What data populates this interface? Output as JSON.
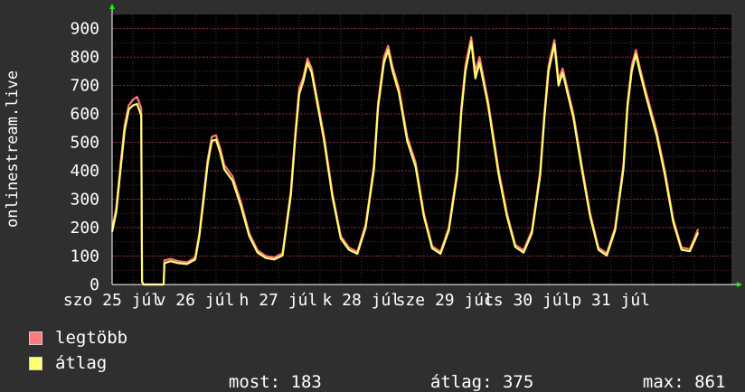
{
  "chart_data": {
    "type": "line",
    "ylabel": "onlinestream.live",
    "ylim": [
      0,
      950
    ],
    "yticks": [
      0,
      100,
      200,
      300,
      400,
      500,
      600,
      700,
      800,
      900
    ],
    "xlim": [
      0,
      7.45
    ],
    "x_tick_labels": [
      {
        "x": 0.0,
        "label": "szo 25 júl"
      },
      {
        "x": 1.0,
        "label": "v 26 júl"
      },
      {
        "x": 2.0,
        "label": "h 27 júl"
      },
      {
        "x": 3.0,
        "label": "k 28 júl"
      },
      {
        "x": 4.0,
        "label": "sze 29 júl"
      },
      {
        "x": 5.0,
        "label": "cs 30 júl"
      },
      {
        "x": 6.0,
        "label": "p 31 júl"
      }
    ],
    "grid": true,
    "colors": {
      "background": "#000000",
      "grid": "#5a2a2a",
      "series_max": "#ff7a7a",
      "series_avg": "#ffff70",
      "axis_arrow": "#00ff00"
    },
    "series": [
      {
        "name": "legtöbb",
        "color": "#ff7a7a",
        "points": [
          [
            0.0,
            195
          ],
          [
            0.05,
            270
          ],
          [
            0.1,
            420
          ],
          [
            0.15,
            560
          ],
          [
            0.2,
            630
          ],
          [
            0.25,
            650
          ],
          [
            0.3,
            660
          ],
          [
            0.35,
            620
          ],
          [
            0.36,
            10
          ],
          [
            0.38,
            0
          ],
          [
            0.62,
            0
          ],
          [
            0.63,
            85
          ],
          [
            0.7,
            90
          ],
          [
            0.8,
            82
          ],
          [
            0.9,
            78
          ],
          [
            1.0,
            95
          ],
          [
            1.05,
            180
          ],
          [
            1.1,
            310
          ],
          [
            1.15,
            440
          ],
          [
            1.2,
            520
          ],
          [
            1.25,
            525
          ],
          [
            1.3,
            480
          ],
          [
            1.35,
            420
          ],
          [
            1.45,
            380
          ],
          [
            1.55,
            290
          ],
          [
            1.65,
            180
          ],
          [
            1.75,
            120
          ],
          [
            1.85,
            100
          ],
          [
            1.95,
            95
          ],
          [
            2.05,
            110
          ],
          [
            2.15,
            330
          ],
          [
            2.2,
            520
          ],
          [
            2.25,
            690
          ],
          [
            2.3,
            730
          ],
          [
            2.35,
            795
          ],
          [
            2.4,
            760
          ],
          [
            2.45,
            680
          ],
          [
            2.55,
            520
          ],
          [
            2.65,
            320
          ],
          [
            2.75,
            170
          ],
          [
            2.85,
            130
          ],
          [
            2.95,
            115
          ],
          [
            3.05,
            210
          ],
          [
            3.15,
            420
          ],
          [
            3.2,
            640
          ],
          [
            3.27,
            800
          ],
          [
            3.32,
            840
          ],
          [
            3.37,
            770
          ],
          [
            3.45,
            690
          ],
          [
            3.55,
            520
          ],
          [
            3.65,
            430
          ],
          [
            3.75,
            250
          ],
          [
            3.85,
            135
          ],
          [
            3.95,
            115
          ],
          [
            4.05,
            200
          ],
          [
            4.15,
            400
          ],
          [
            4.2,
            620
          ],
          [
            4.25,
            770
          ],
          [
            4.32,
            870
          ],
          [
            4.37,
            750
          ],
          [
            4.42,
            800
          ],
          [
            4.52,
            650
          ],
          [
            4.65,
            400
          ],
          [
            4.75,
            250
          ],
          [
            4.85,
            140
          ],
          [
            4.95,
            120
          ],
          [
            5.05,
            190
          ],
          [
            5.15,
            400
          ],
          [
            5.2,
            600
          ],
          [
            5.25,
            770
          ],
          [
            5.32,
            860
          ],
          [
            5.37,
            720
          ],
          [
            5.42,
            760
          ],
          [
            5.55,
            600
          ],
          [
            5.65,
            420
          ],
          [
            5.75,
            250
          ],
          [
            5.85,
            130
          ],
          [
            5.95,
            110
          ],
          [
            6.05,
            200
          ],
          [
            6.15,
            420
          ],
          [
            6.2,
            640
          ],
          [
            6.25,
            770
          ],
          [
            6.3,
            825
          ],
          [
            6.35,
            760
          ],
          [
            6.42,
            680
          ],
          [
            6.55,
            540
          ],
          [
            6.65,
            400
          ],
          [
            6.75,
            230
          ],
          [
            6.85,
            130
          ],
          [
            6.95,
            125
          ],
          [
            7.05,
            195
          ]
        ]
      },
      {
        "name": "átlag",
        "color": "#ffff70",
        "points": [
          [
            0.0,
            185
          ],
          [
            0.05,
            255
          ],
          [
            0.1,
            400
          ],
          [
            0.15,
            540
          ],
          [
            0.2,
            615
          ],
          [
            0.25,
            630
          ],
          [
            0.3,
            635
          ],
          [
            0.35,
            595
          ],
          [
            0.36,
            10
          ],
          [
            0.38,
            0
          ],
          [
            0.62,
            0
          ],
          [
            0.63,
            75
          ],
          [
            0.7,
            82
          ],
          [
            0.8,
            75
          ],
          [
            0.9,
            72
          ],
          [
            1.0,
            88
          ],
          [
            1.05,
            170
          ],
          [
            1.1,
            295
          ],
          [
            1.15,
            425
          ],
          [
            1.2,
            505
          ],
          [
            1.25,
            510
          ],
          [
            1.3,
            465
          ],
          [
            1.35,
            405
          ],
          [
            1.45,
            365
          ],
          [
            1.55,
            275
          ],
          [
            1.65,
            170
          ],
          [
            1.75,
            112
          ],
          [
            1.85,
            93
          ],
          [
            1.95,
            88
          ],
          [
            2.05,
            102
          ],
          [
            2.15,
            315
          ],
          [
            2.2,
            505
          ],
          [
            2.25,
            670
          ],
          [
            2.3,
            715
          ],
          [
            2.35,
            780
          ],
          [
            2.4,
            745
          ],
          [
            2.45,
            665
          ],
          [
            2.55,
            505
          ],
          [
            2.65,
            308
          ],
          [
            2.75,
            162
          ],
          [
            2.85,
            122
          ],
          [
            2.95,
            108
          ],
          [
            3.05,
            200
          ],
          [
            3.15,
            405
          ],
          [
            3.2,
            625
          ],
          [
            3.27,
            780
          ],
          [
            3.32,
            825
          ],
          [
            3.37,
            755
          ],
          [
            3.45,
            675
          ],
          [
            3.55,
            505
          ],
          [
            3.65,
            415
          ],
          [
            3.75,
            240
          ],
          [
            3.85,
            127
          ],
          [
            3.95,
            108
          ],
          [
            4.05,
            190
          ],
          [
            4.15,
            385
          ],
          [
            4.2,
            605
          ],
          [
            4.25,
            750
          ],
          [
            4.32,
            855
          ],
          [
            4.37,
            725
          ],
          [
            4.42,
            780
          ],
          [
            4.52,
            635
          ],
          [
            4.65,
            385
          ],
          [
            4.75,
            240
          ],
          [
            4.85,
            132
          ],
          [
            4.95,
            112
          ],
          [
            5.05,
            180
          ],
          [
            5.15,
            385
          ],
          [
            5.2,
            585
          ],
          [
            5.25,
            750
          ],
          [
            5.32,
            845
          ],
          [
            5.37,
            700
          ],
          [
            5.42,
            745
          ],
          [
            5.55,
            585
          ],
          [
            5.65,
            405
          ],
          [
            5.75,
            240
          ],
          [
            5.85,
            122
          ],
          [
            5.95,
            102
          ],
          [
            6.05,
            190
          ],
          [
            6.15,
            405
          ],
          [
            6.2,
            625
          ],
          [
            6.25,
            750
          ],
          [
            6.3,
            810
          ],
          [
            6.35,
            745
          ],
          [
            6.42,
            665
          ],
          [
            6.55,
            525
          ],
          [
            6.65,
            385
          ],
          [
            6.75,
            220
          ],
          [
            6.85,
            122
          ],
          [
            6.95,
            117
          ],
          [
            7.05,
            183
          ]
        ]
      }
    ]
  },
  "legend": {
    "items": [
      {
        "label": "legtöbb",
        "color": "#ff7a7a"
      },
      {
        "label": "átlag",
        "color": "#ffff70"
      }
    ],
    "stats": [
      {
        "label": "most:",
        "value": "183"
      },
      {
        "label": "átlag:",
        "value": "375"
      },
      {
        "label": "max:",
        "value": "861"
      }
    ]
  }
}
